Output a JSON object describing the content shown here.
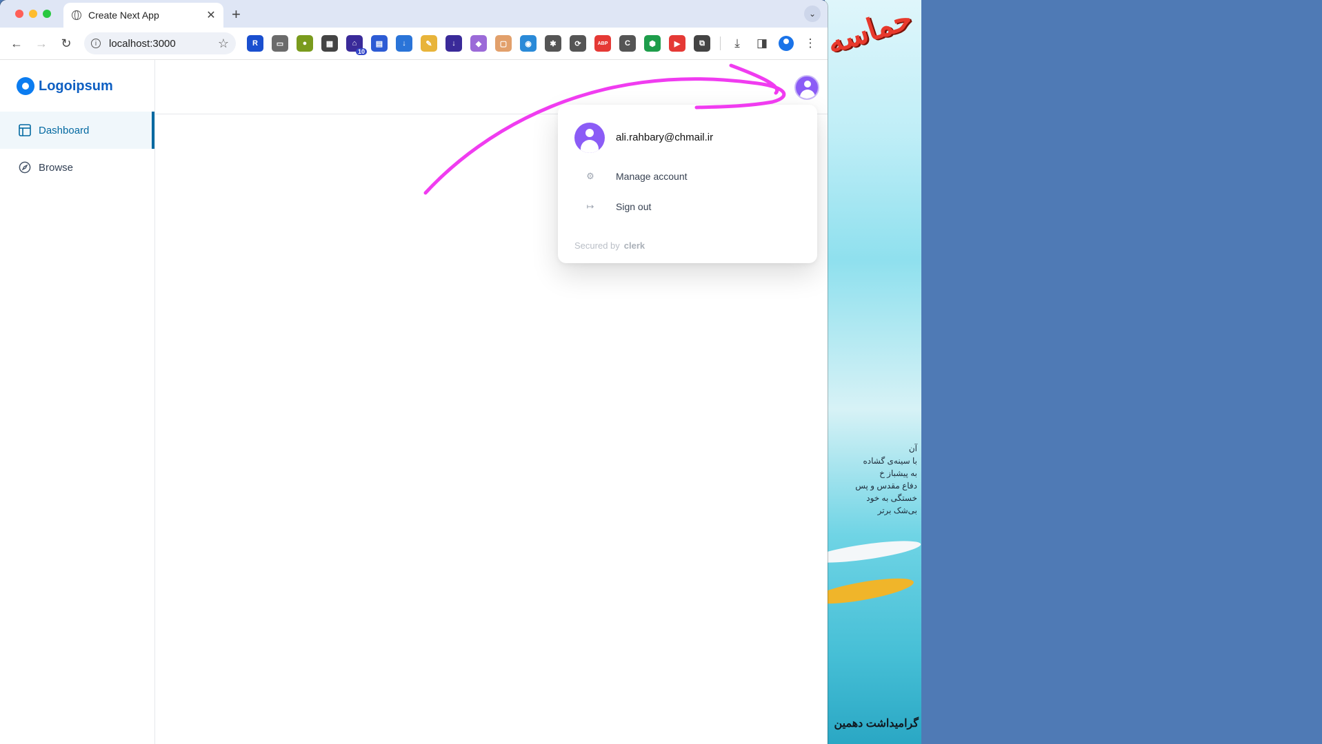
{
  "browser": {
    "tab_title": "Create Next App",
    "new_tab_symbol": "+",
    "url": "localhost:3000"
  },
  "toolbar_icons": [
    "back-icon",
    "forward-icon",
    "reload-icon",
    "bookmark-star-icon",
    "downloads-icon",
    "side-panel-icon",
    "profile-icon",
    "menu-icon"
  ],
  "extensions": [
    {
      "name": "extension-1-icon",
      "color": "#1a4fcf",
      "glyph": "R"
    },
    {
      "name": "extension-2-icon",
      "color": "#6b6b6b",
      "glyph": "▭"
    },
    {
      "name": "extension-3-icon",
      "color": "#7a9b1d",
      "glyph": "●"
    },
    {
      "name": "extension-4-icon",
      "color": "#444444",
      "glyph": "▦"
    },
    {
      "name": "extension-5-icon",
      "color": "#3a2a99",
      "glyph": "⌂",
      "badge": "10"
    },
    {
      "name": "extension-6-icon",
      "color": "#2d5bd4",
      "glyph": "▤"
    },
    {
      "name": "extension-7-icon",
      "color": "#2a74d8",
      "glyph": "↓"
    },
    {
      "name": "extension-8-icon",
      "color": "#e8b43a",
      "glyph": "✎"
    },
    {
      "name": "extension-9-icon",
      "color": "#3a2a99",
      "glyph": "↓"
    },
    {
      "name": "extension-10-icon",
      "color": "#9b6ad8",
      "glyph": "◆"
    },
    {
      "name": "extension-11-icon",
      "color": "#e2a06b",
      "glyph": "▢"
    },
    {
      "name": "extension-12-icon",
      "color": "#2a8ad8",
      "glyph": "◉"
    },
    {
      "name": "extension-13-icon",
      "color": "#555555",
      "glyph": "✱"
    },
    {
      "name": "extension-14-icon",
      "color": "#555555",
      "glyph": "⟳"
    },
    {
      "name": "extension-15-icon",
      "color": "#e53935",
      "glyph": "ABP"
    },
    {
      "name": "extension-16-icon",
      "color": "#555555",
      "glyph": "C"
    },
    {
      "name": "extension-17-icon",
      "color": "#1e9d4b",
      "glyph": "⬢"
    },
    {
      "name": "extension-18-icon",
      "color": "#e53935",
      "glyph": "▶"
    },
    {
      "name": "extensions-puzzle-icon",
      "color": "#444444",
      "glyph": "⧉"
    }
  ],
  "sidebar": {
    "logo_text": "Logoipsum",
    "items": [
      {
        "label": "Dashboard",
        "icon": "layout-icon",
        "active": true
      },
      {
        "label": "Browse",
        "icon": "compass-icon",
        "active": false
      }
    ]
  },
  "user_menu": {
    "email": "ali.rahbary@chmail.ir",
    "manage_label": "Manage account",
    "signout_label": "Sign out",
    "secured_by": "Secured by",
    "brand": "clerk"
  },
  "desktop_art": {
    "lines": [
      "آن",
      "با سینه‌ی گشاده",
      "به پیشباز خ",
      "دفاع مقدس و پس",
      "خستگی به خود",
      "بی‌شک برتر"
    ],
    "bottom": "گرامیداشت دهمین"
  },
  "colors": {
    "accent": "#0369a1",
    "avatar": "#8b5cf6",
    "annotation": "#f03cf0"
  }
}
